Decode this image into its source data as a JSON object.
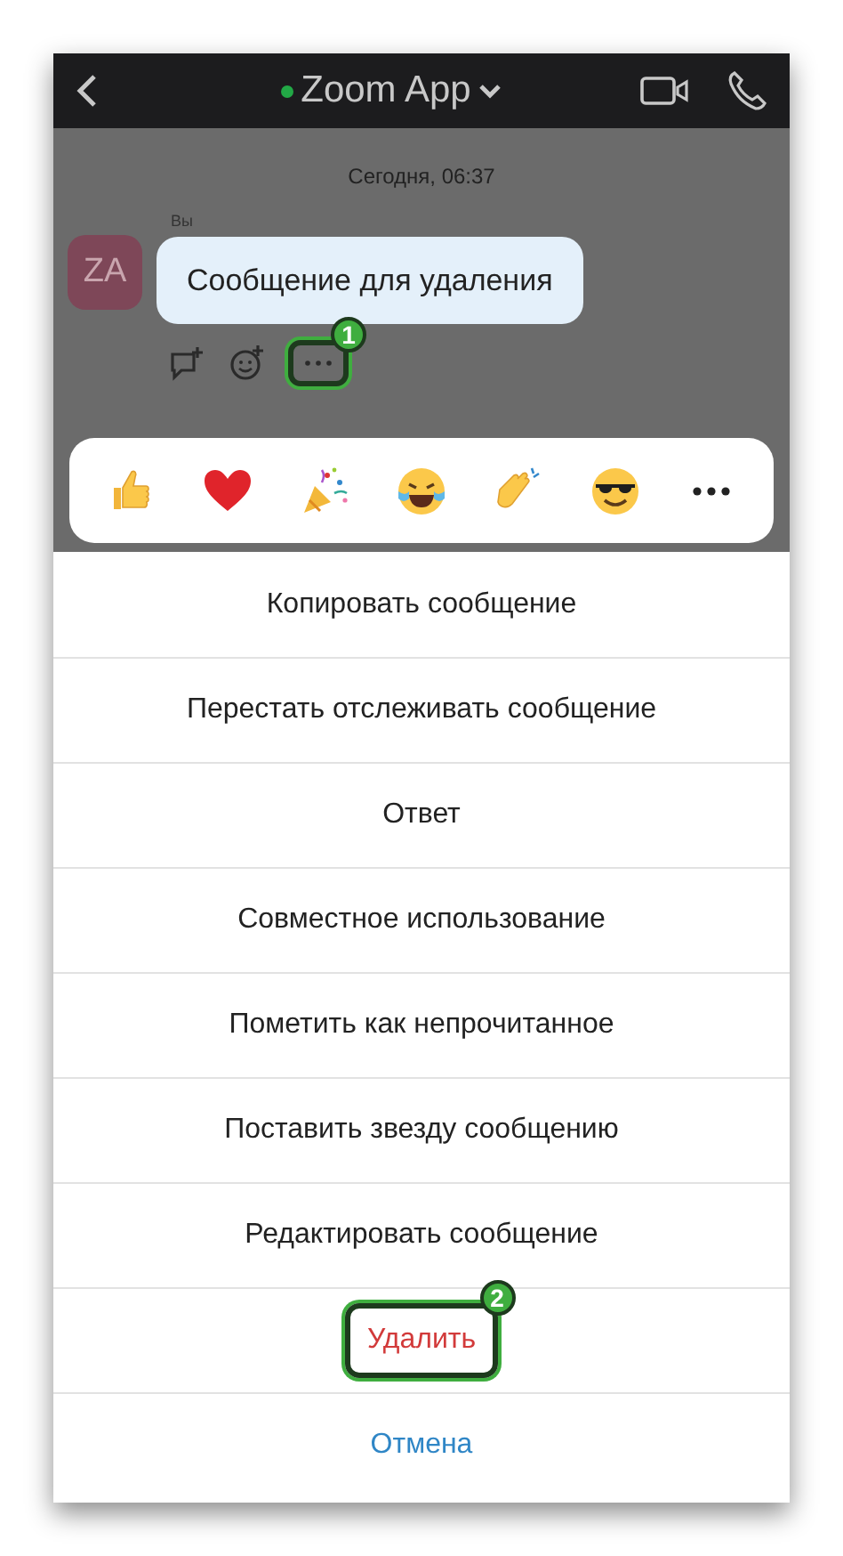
{
  "header": {
    "title": "Zoom App",
    "online": true
  },
  "date": "Сегодня, 06:37",
  "message": {
    "sender": "Вы",
    "avatar": "ZA",
    "text": "Сообщение для удаления"
  },
  "message_actions": [
    {
      "kind": "reply",
      "highlighted": false
    },
    {
      "kind": "react",
      "highlighted": false
    },
    {
      "kind": "more",
      "highlighted": true,
      "callout": "1"
    }
  ],
  "reactions": [
    {
      "kind": "thumbs_up"
    },
    {
      "kind": "heart"
    },
    {
      "kind": "party"
    },
    {
      "kind": "laugh"
    },
    {
      "kind": "clap"
    },
    {
      "kind": "cool"
    },
    {
      "kind": "more"
    }
  ],
  "menu": [
    {
      "label": "Копировать сообщение",
      "kind": "normal",
      "highlighted": false
    },
    {
      "label": "Перестать отслеживать сообщение",
      "kind": "normal",
      "highlighted": false
    },
    {
      "label": "Ответ",
      "kind": "normal",
      "highlighted": false
    },
    {
      "label": "Совместное использование",
      "kind": "normal",
      "highlighted": false
    },
    {
      "label": "Пометить как непрочитанное",
      "kind": "normal",
      "highlighted": false
    },
    {
      "label": "Поставить звезду сообщению",
      "kind": "normal",
      "highlighted": false
    },
    {
      "label": "Редактировать сообщение",
      "kind": "normal",
      "highlighted": false
    },
    {
      "label": "Удалить",
      "kind": "destructive",
      "highlighted": true,
      "callout": "2"
    },
    {
      "label": "Отмена",
      "kind": "cancel",
      "highlighted": false
    }
  ]
}
